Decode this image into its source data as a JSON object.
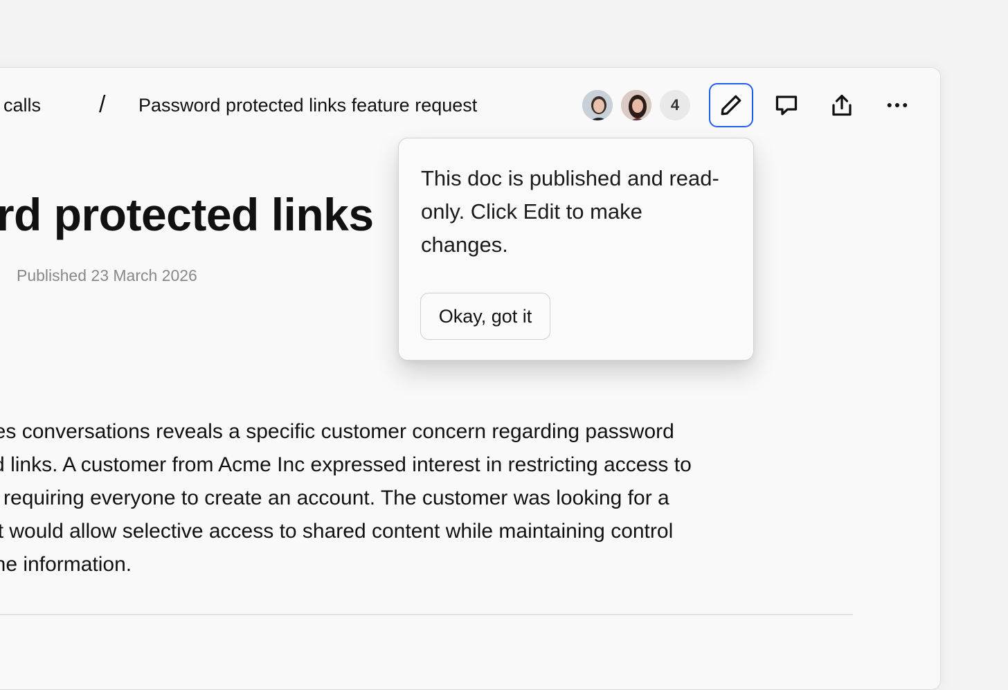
{
  "breadcrumb": {
    "previous": "ery calls",
    "separator": "/",
    "current": "Password protected links feature request"
  },
  "collaborators": {
    "extra_count": "4"
  },
  "toolbar": {
    "edit_icon": "pencil-icon",
    "comment_icon": "comment-icon",
    "share_icon": "share-icon",
    "more_icon": "more-icon",
    "accent_color": "#1f5cf0"
  },
  "document": {
    "title": "ord protected links",
    "published": "Published 23 March 2026",
    "body_lines": [
      "s sales conversations reveals a specific customer concern regarding password",
      "hared links. A customer from Acme Inc expressed interest in restricting access to",
      "thout requiring everyone to create an account. The customer was looking for a",
      "n that would allow selective access to shared content while maintaining control",
      "iew the information."
    ]
  },
  "popover": {
    "message": "This doc is published and read-only. Click Edit to make changes.",
    "button_label": "Okay, got it"
  }
}
